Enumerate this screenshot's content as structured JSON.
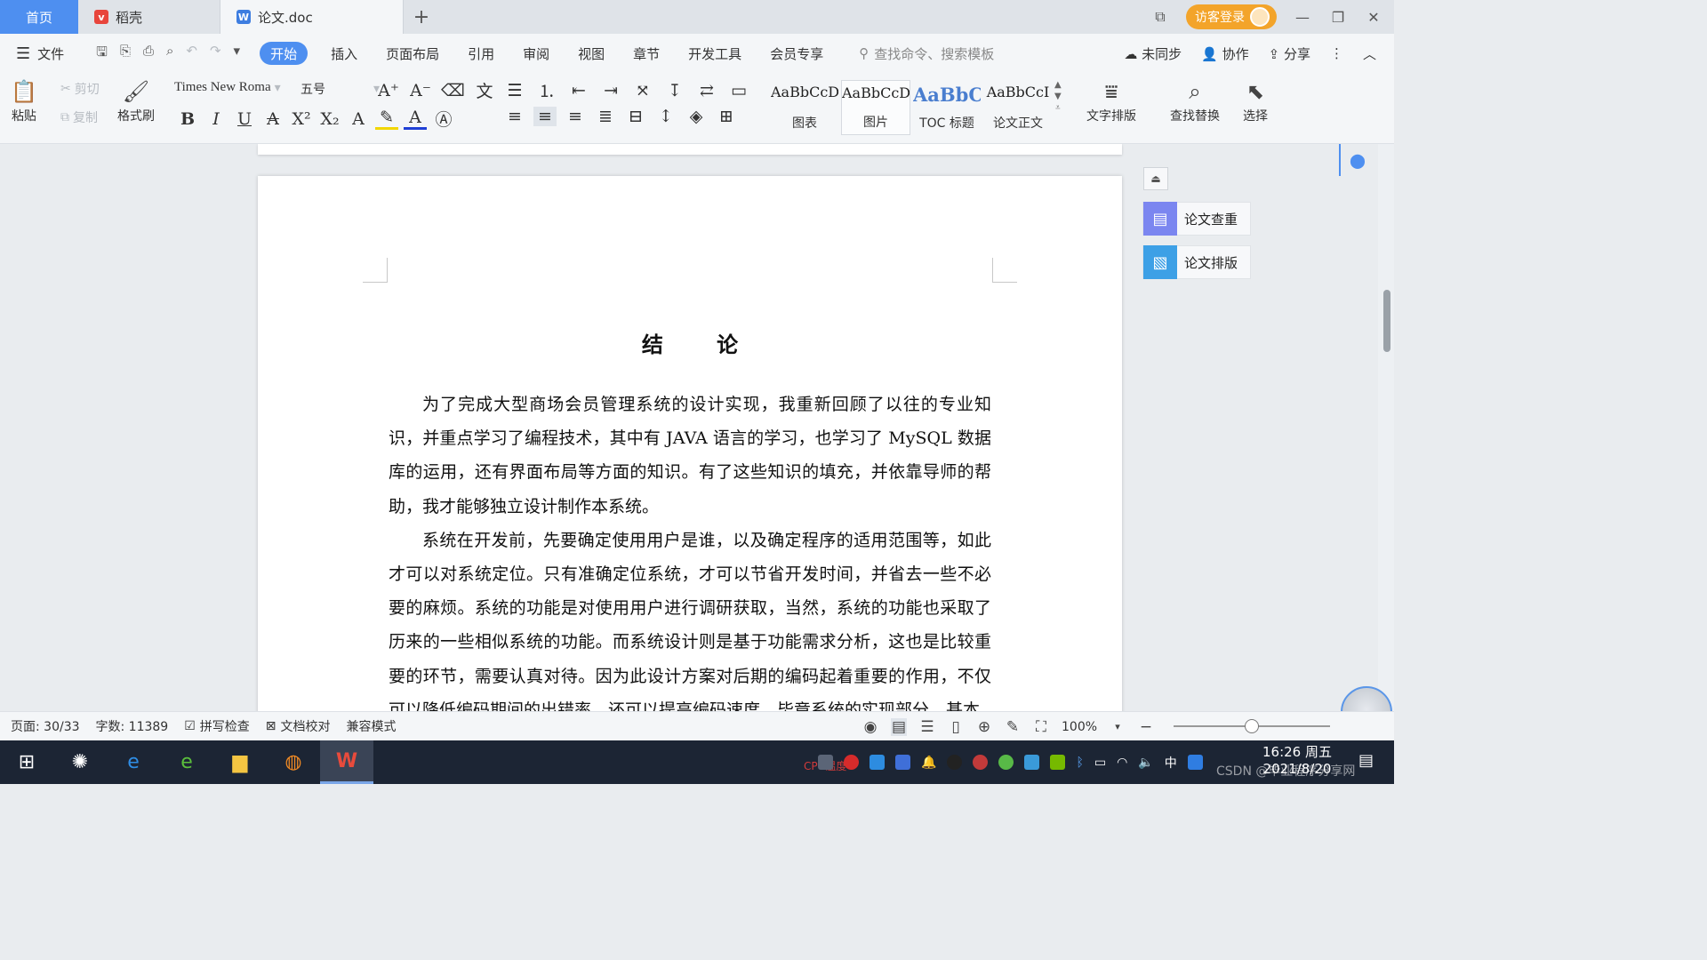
{
  "tabs": {
    "home": "首页",
    "daoke": "稻壳",
    "doc": "论文.doc"
  },
  "titlebar": {
    "login": "访客登录"
  },
  "menu": {
    "file": "文件",
    "items": [
      "开始",
      "插入",
      "页面布局",
      "引用",
      "审阅",
      "视图",
      "章节",
      "开发工具",
      "会员专享"
    ],
    "active": "开始",
    "search_placeholder": "查找命令、搜索模板",
    "sync": "未同步",
    "collab": "协作",
    "share": "分享"
  },
  "ribbon": {
    "paste": "粘贴",
    "cut": "剪切",
    "copy": "复制",
    "format_painter": "格式刷",
    "font_name": "Times New Roma",
    "font_size": "五号",
    "styles": [
      {
        "preview": "AaBbCcDd",
        "label": "图表"
      },
      {
        "preview": "AaBbCcDd",
        "label": "图片"
      },
      {
        "preview": "AaBbCc",
        "label": "TOC 标题"
      },
      {
        "preview": "AaBbCcI",
        "label": "论文正文"
      }
    ],
    "text_layout": "文字排版",
    "find_replace": "查找替换",
    "select": "选择"
  },
  "document": {
    "title": "结 论",
    "paragraphs": [
      "为了完成大型商场会员管理系统的设计实现，我重新回顾了以往的专业知识，并重点学习了编程技术，其中有 JAVA 语言的学习，也学习了 MySQL 数据库的运用，还有界面布局等方面的知识。有了这些知识的填充，并依靠导师的帮助，我才能够独立设计制作本系统。",
      "系统在开发前，先要确定使用用户是谁，以及确定程序的适用范围等，如此才可以对系统定位。只有准确定位系统，才可以节省开发时间，并省去一些不必要的麻烦。系统的功能是对使用用户进行调研获取，当然，系统的功能也采取了历来的一些相似系统的功能。而系统设计则是基于功能需求分析，这也是比较重要的环节，需要认真对待。因为此设计方案对后期的编码起着重要的作用，不仅可以降低编码期间的出错率，还可以提高编码速度，毕竟系统的实现部分，基本"
    ]
  },
  "side_panel": {
    "check": "论文查重",
    "layout": "论文排版"
  },
  "status": {
    "page": "页面: 30/33",
    "words": "字数: 11389",
    "spell": "拼写检查",
    "proof": "文档校对",
    "compat": "兼容模式",
    "zoom": "100%",
    "zoom_level": 0.5
  },
  "taskbar": {
    "cpu_label": "CPU温度",
    "time": "16:26 周五",
    "date": "2021/8/20",
    "watermark": "CSDN @毕业程序分享网"
  },
  "colors": {
    "accent": "#4e8ff0",
    "login": "#f3a42a",
    "taskbar": "#1c2534"
  }
}
